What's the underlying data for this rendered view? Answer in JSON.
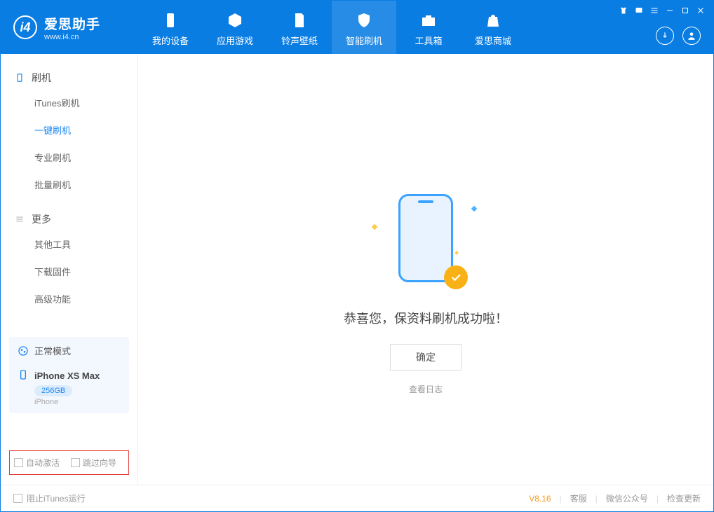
{
  "brand": {
    "name": "爱思助手",
    "url": "www.i4.cn"
  },
  "tabs": [
    {
      "label": "我的设备"
    },
    {
      "label": "应用游戏"
    },
    {
      "label": "铃声壁纸"
    },
    {
      "label": "智能刷机"
    },
    {
      "label": "工具箱"
    },
    {
      "label": "爱思商城"
    }
  ],
  "sidebar": {
    "section1": "刷机",
    "items1": [
      {
        "label": "iTunes刷机"
      },
      {
        "label": "一键刷机"
      },
      {
        "label": "专业刷机"
      },
      {
        "label": "批量刷机"
      }
    ],
    "section2": "更多",
    "items2": [
      {
        "label": "其他工具"
      },
      {
        "label": "下载固件"
      },
      {
        "label": "高级功能"
      }
    ],
    "mode": "正常模式",
    "device": {
      "name": "iPhone XS Max",
      "storage": "256GB",
      "type": "iPhone"
    },
    "options": {
      "opt1": "自动激活",
      "opt2": "跳过向导"
    }
  },
  "main": {
    "success_text": "恭喜您，保资料刷机成功啦！",
    "ok": "确定",
    "log": "查看日志"
  },
  "footer": {
    "stop_itunes": "阻止iTunes运行",
    "version": "V8.16",
    "link1": "客服",
    "link2": "微信公众号",
    "link3": "检查更新"
  }
}
